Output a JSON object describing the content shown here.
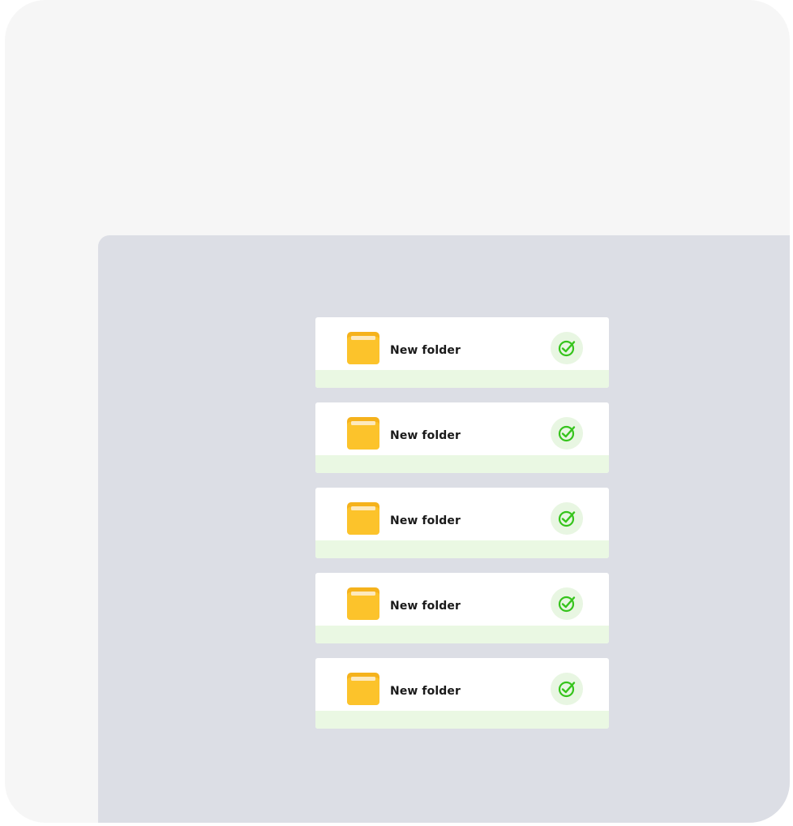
{
  "folders": [
    {
      "label": "New folder",
      "status": "synced",
      "icon": "folder-icon",
      "status_icon": "check-circle-icon"
    },
    {
      "label": "New folder",
      "status": "synced",
      "icon": "folder-icon",
      "status_icon": "check-circle-icon"
    },
    {
      "label": "New folder",
      "status": "synced",
      "icon": "folder-icon",
      "status_icon": "check-circle-icon"
    },
    {
      "label": "New folder",
      "status": "synced",
      "icon": "folder-icon",
      "status_icon": "check-circle-icon"
    },
    {
      "label": "New folder",
      "status": "synced",
      "icon": "folder-icon",
      "status_icon": "check-circle-icon"
    }
  ],
  "colors": {
    "folder": "#fcc32b",
    "folder_tab": "#f5b21c",
    "check": "#36c41c",
    "check_bg": "#e8f6e2",
    "card_strip": "#eaf8e3",
    "panel_bg": "#dcdee5",
    "outer_bg": "#f6f6f6"
  }
}
